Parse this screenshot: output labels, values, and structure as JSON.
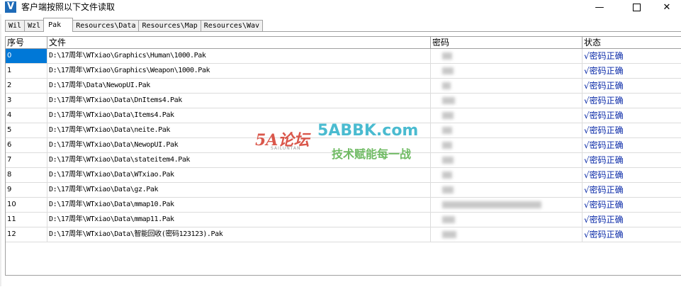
{
  "window": {
    "title": "客户端按照以下文件读取"
  },
  "tabs": [
    "Wil",
    "Wzl",
    "Pak",
    "Resources\\Data",
    "Resources\\Map",
    "Resources\\Wav"
  ],
  "active_tab": "Pak",
  "table": {
    "headers": [
      "序号",
      "文件",
      "密码",
      "状态"
    ],
    "rows": [
      {
        "idx": "0",
        "file": "D:\\17周年\\WTxiao\\Graphics\\Human\\1000.Pak",
        "status": "√密码正确"
      },
      {
        "idx": "1",
        "file": "D:\\17周年\\WTxiao\\Graphics\\Weapon\\1000.Pak",
        "status": "√密码正确"
      },
      {
        "idx": "2",
        "file": "D:\\17周年\\Data\\NewopUI.Pak",
        "status": "√密码正确"
      },
      {
        "idx": "3",
        "file": "D:\\17周年\\WTxiao\\Data\\DnItems4.Pak",
        "status": "√密码正确"
      },
      {
        "idx": "4",
        "file": "D:\\17周年\\WTxiao\\Data\\Items4.Pak",
        "status": "√密码正确"
      },
      {
        "idx": "5",
        "file": "D:\\17周年\\WTxiao\\Data\\neite.Pak",
        "status": "√密码正确"
      },
      {
        "idx": "6",
        "file": "D:\\17周年\\WTxiao\\Data\\NewopUI.Pak",
        "status": "√密码正确"
      },
      {
        "idx": "7",
        "file": "D:\\17周年\\WTxiao\\Data\\stateitem4.Pak",
        "status": "√密码正确"
      },
      {
        "idx": "8",
        "file": "D:\\17周年\\WTxiao\\Data\\WTxiao.Pak",
        "status": "√密码正确"
      },
      {
        "idx": "9",
        "file": "D:\\17周年\\WTxiao\\Data\\gz.Pak",
        "status": "√密码正确"
      },
      {
        "idx": "10",
        "file": "D:\\17周年\\WTxiao\\Data\\mmap10.Pak",
        "status": "√密码正确"
      },
      {
        "idx": "11",
        "file": "D:\\17周年\\WTxiao\\Data\\mmap11.Pak",
        "status": "√密码正确"
      },
      {
        "idx": "12",
        "file": "D:\\17周年\\WTxiao\\Data\\智能回收(密码123123).Pak",
        "status": "√密码正确"
      }
    ]
  },
  "watermark": {
    "logo": "5A论坛",
    "logo_sub": "SAILUNTAN",
    "url": "5ABBK.com",
    "slogan": "技术赋能每一战"
  }
}
